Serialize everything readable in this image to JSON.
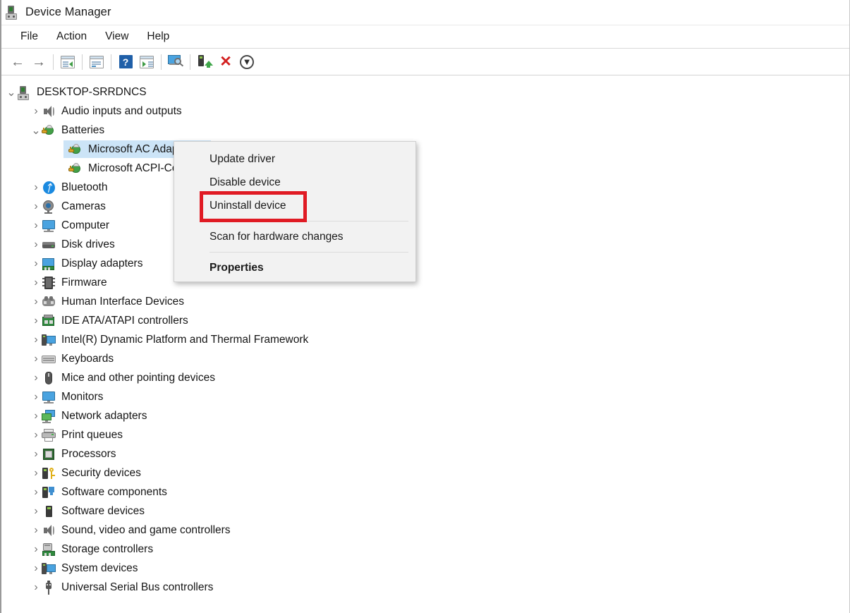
{
  "window": {
    "title": "Device Manager",
    "title_icon": "device-manager-icon"
  },
  "menubar": {
    "items": [
      {
        "label": "File"
      },
      {
        "label": "Action"
      },
      {
        "label": "View"
      },
      {
        "label": "Help"
      }
    ]
  },
  "toolbar": {
    "buttons": [
      {
        "name": "back-button",
        "icon": "back-arrow-icon",
        "glyph": "←"
      },
      {
        "name": "forward-button",
        "icon": "forward-arrow-icon",
        "glyph": "→"
      },
      {
        "name": "show-hide-console-tree-button",
        "icon": "console-tree-icon"
      },
      {
        "name": "properties-button",
        "icon": "properties-window-icon"
      },
      {
        "name": "help-button",
        "icon": "help-question-icon",
        "glyph": "?"
      },
      {
        "name": "show-hide-action-pane-button",
        "icon": "action-pane-icon"
      },
      {
        "name": "scan-for-hardware-changes-button",
        "icon": "scan-hardware-icon"
      },
      {
        "name": "update-driver-button",
        "icon": "update-driver-icon"
      },
      {
        "name": "uninstall-device-button",
        "icon": "red-x-icon",
        "glyph": "✕"
      },
      {
        "name": "disable-device-button",
        "icon": "down-arrow-circle-icon",
        "glyph": "⬇"
      }
    ]
  },
  "tree": {
    "root": {
      "label": "DESKTOP-SRRDNCS",
      "icon": "computer-root-icon",
      "expanded": true,
      "chevron": "⌄"
    },
    "nodes": [
      {
        "label": "Audio inputs and outputs",
        "icon": "speaker-icon",
        "expanded": false,
        "level": 1
      },
      {
        "label": "Batteries",
        "icon": "battery-icon",
        "expanded": true,
        "level": 1
      },
      {
        "label": "Microsoft AC Adapter",
        "icon": "battery-icon",
        "level": 2,
        "selected": true
      },
      {
        "label": "Microsoft ACPI-Compliant Control Method Battery",
        "icon": "battery-icon",
        "level": 2,
        "selected": false
      },
      {
        "label": "Bluetooth",
        "icon": "bluetooth-icon",
        "expanded": false,
        "level": 1
      },
      {
        "label": "Cameras",
        "icon": "camera-icon",
        "expanded": false,
        "level": 1
      },
      {
        "label": "Computer",
        "icon": "monitor-icon",
        "expanded": false,
        "level": 1
      },
      {
        "label": "Disk drives",
        "icon": "disk-drive-icon",
        "expanded": false,
        "level": 1
      },
      {
        "label": "Display adapters",
        "icon": "display-adapter-icon",
        "expanded": false,
        "level": 1
      },
      {
        "label": "Firmware",
        "icon": "firmware-chip-icon",
        "expanded": false,
        "level": 1
      },
      {
        "label": "Human Interface Devices",
        "icon": "hid-icon",
        "expanded": false,
        "level": 1
      },
      {
        "label": "IDE ATA/ATAPI controllers",
        "icon": "ide-controller-icon",
        "expanded": false,
        "level": 1
      },
      {
        "label": "Intel(R) Dynamic Platform and Thermal Framework",
        "icon": "system-device-icon",
        "expanded": false,
        "level": 1
      },
      {
        "label": "Keyboards",
        "icon": "keyboard-icon",
        "expanded": false,
        "level": 1
      },
      {
        "label": "Mice and other pointing devices",
        "icon": "mouse-icon",
        "expanded": false,
        "level": 1
      },
      {
        "label": "Monitors",
        "icon": "monitor-icon",
        "expanded": false,
        "level": 1
      },
      {
        "label": "Network adapters",
        "icon": "network-adapter-icon",
        "expanded": false,
        "level": 1
      },
      {
        "label": "Print queues",
        "icon": "printer-icon",
        "expanded": false,
        "level": 1
      },
      {
        "label": "Processors",
        "icon": "processor-icon",
        "expanded": false,
        "level": 1
      },
      {
        "label": "Security devices",
        "icon": "security-device-icon",
        "expanded": false,
        "level": 1
      },
      {
        "label": "Software components",
        "icon": "software-component-icon",
        "expanded": false,
        "level": 1
      },
      {
        "label": "Software devices",
        "icon": "software-device-icon",
        "expanded": false,
        "level": 1
      },
      {
        "label": "Sound, video and game controllers",
        "icon": "speaker-icon",
        "expanded": false,
        "level": 1
      },
      {
        "label": "Storage controllers",
        "icon": "storage-controller-icon",
        "expanded": false,
        "level": 1
      },
      {
        "label": "System devices",
        "icon": "system-device-icon",
        "expanded": false,
        "level": 1
      },
      {
        "label": "Universal Serial Bus controllers",
        "icon": "usb-icon",
        "expanded": false,
        "level": 1
      }
    ],
    "chevron_collapsed": "›",
    "chevron_expanded": "⌄",
    "selection_color": "#cce4f7"
  },
  "context_menu": {
    "items": [
      {
        "label": "Update driver",
        "bold": false,
        "highlighted": false
      },
      {
        "label": "Disable device",
        "bold": false,
        "highlighted": false
      },
      {
        "label": "Uninstall device",
        "bold": false,
        "highlighted": true
      },
      {
        "label": "Scan for hardware changes",
        "bold": false,
        "highlighted": false
      },
      {
        "label": "Properties",
        "bold": true,
        "highlighted": false
      }
    ],
    "highlight_color": "#e01b24",
    "background": "#f2f2f2"
  }
}
